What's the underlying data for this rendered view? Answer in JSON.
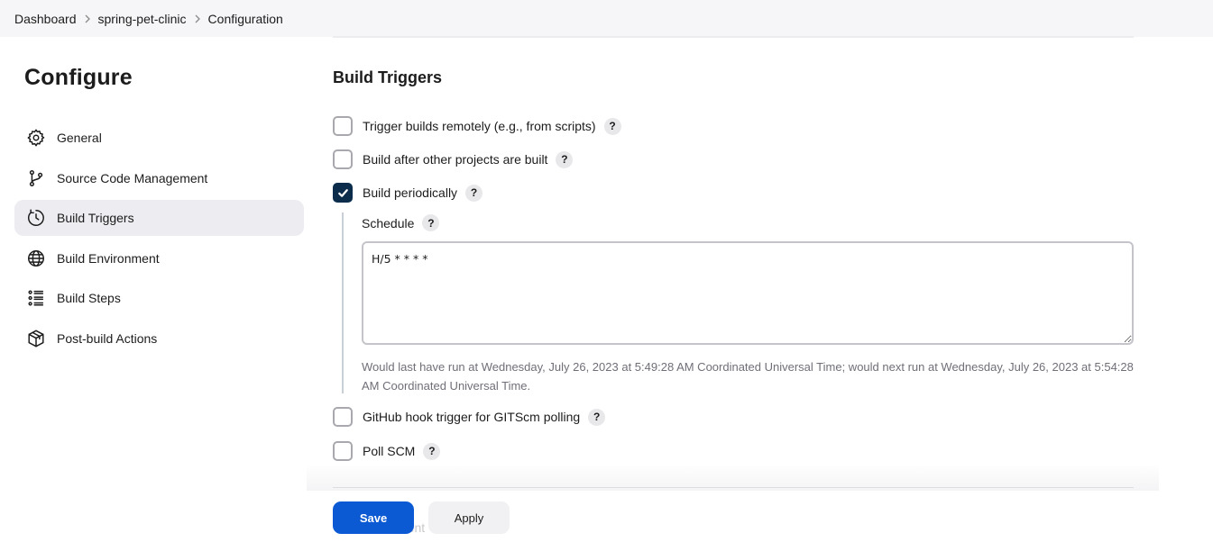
{
  "breadcrumb": {
    "items": [
      "Dashboard",
      "spring-pet-clinic",
      "Configuration"
    ]
  },
  "page": {
    "heading": "Configure"
  },
  "sidebar": {
    "items": [
      {
        "label": "General",
        "icon": "gear-icon"
      },
      {
        "label": "Source Code Management",
        "icon": "branch-icon"
      },
      {
        "label": "Build Triggers",
        "icon": "clock-icon",
        "active": true
      },
      {
        "label": "Build Environment",
        "icon": "globe-icon"
      },
      {
        "label": "Build Steps",
        "icon": "list-icon"
      },
      {
        "label": "Post-build Actions",
        "icon": "package-icon"
      }
    ]
  },
  "build_triggers": {
    "title": "Build Triggers",
    "options": [
      {
        "label": "Trigger builds remotely (e.g., from scripts)",
        "checked": false
      },
      {
        "label": "Build after other projects are built",
        "checked": false
      },
      {
        "label": "Build periodically",
        "checked": true
      },
      {
        "label": "GitHub hook trigger for GITScm polling",
        "checked": false
      },
      {
        "label": "Poll SCM",
        "checked": false
      }
    ],
    "help_glyph": "?",
    "schedule": {
      "label": "Schedule",
      "value": "H/5 * * * *",
      "hint": "Would last have run at Wednesday, July 26, 2023 at 5:49:28 AM Coordinated Universal Time; would next run at Wednesday, July 26, 2023 at 5:54:28 AM Coordinated Universal Time."
    }
  },
  "footer": {
    "save_label": "Save",
    "apply_label": "Apply",
    "ghost_label": "...ent"
  },
  "colors": {
    "accent": "#0b5ad4",
    "checkbox_checked": "#0b2d4b",
    "sidebar_active": "#ececf1",
    "hint_text": "#6f6f78"
  }
}
